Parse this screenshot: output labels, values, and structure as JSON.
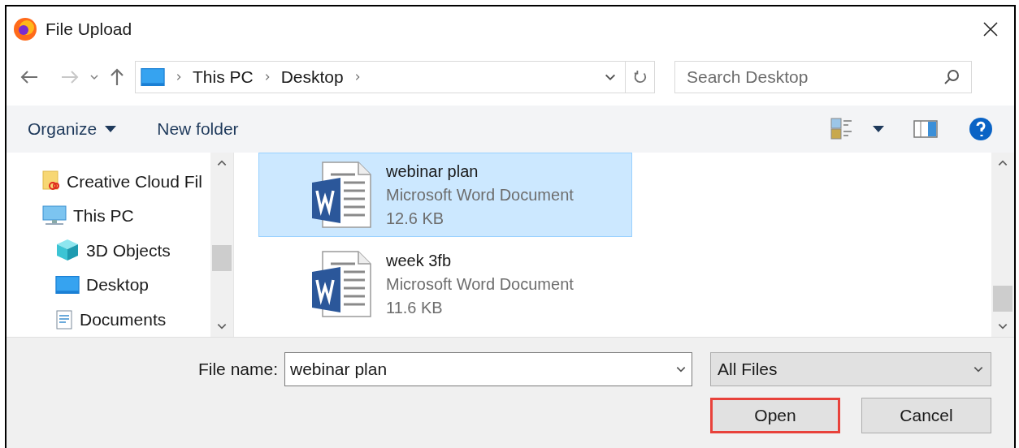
{
  "window": {
    "title": "File Upload"
  },
  "address_bar": {
    "path": [
      "This PC",
      "Desktop"
    ]
  },
  "search": {
    "placeholder": "Search Desktop"
  },
  "toolbar": {
    "organize": "Organize",
    "new_folder": "New folder"
  },
  "navigation": [
    {
      "kind": "cloud",
      "label": "Creative Cloud Fil"
    },
    {
      "kind": "pc",
      "label": "This PC",
      "children": [
        {
          "kind": "cube",
          "label": "3D Objects"
        },
        {
          "kind": "desktop",
          "label": "Desktop"
        },
        {
          "kind": "documents",
          "label": "Documents"
        }
      ]
    }
  ],
  "files": [
    {
      "name": "webinar plan",
      "type": "Microsoft Word Document",
      "size": "12.6 KB",
      "selected": true
    },
    {
      "name": "week 3fb",
      "type": "Microsoft Word Document",
      "size": "11.6 KB",
      "selected": false
    }
  ],
  "file_name": {
    "label": "File name:",
    "value": "webinar plan"
  },
  "file_type": {
    "value": "All Files"
  },
  "buttons": [
    {
      "label": "Open",
      "highlighted": true
    },
    {
      "label": "Cancel",
      "highlighted": false
    }
  ]
}
